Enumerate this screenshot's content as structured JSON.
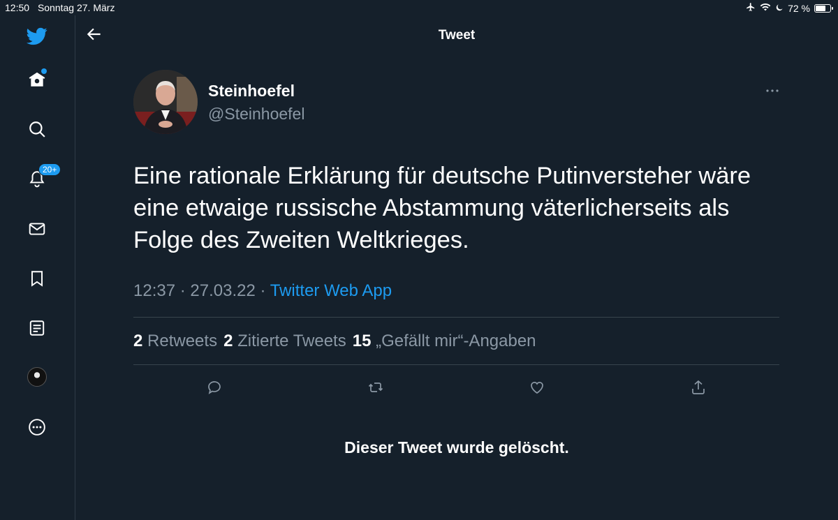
{
  "status_bar": {
    "time": "12:50",
    "date": "Sonntag 27. März",
    "battery": "72 %",
    "battery_level": 0.72
  },
  "sidebar": {
    "notification_count": "20+",
    "items": [
      "twitter-logo",
      "home",
      "explore",
      "notifications",
      "messages",
      "bookmarks",
      "lists",
      "profile",
      "more"
    ]
  },
  "header": {
    "title": "Tweet"
  },
  "tweet": {
    "author_name": "Steinhoefel",
    "author_handle": "@Steinhoefel",
    "text": "Eine rationale Erklärung für deutsche Putinversteher wäre eine etwaige russische Abstammung väterlicherseits als Folge des Zweiten Weltkrieges.",
    "time": "12:37",
    "date": "27.03.22",
    "separator": "·",
    "source": "Twitter Web App",
    "stats": {
      "retweets_count": "2",
      "retweets_label": "Retweets",
      "quotes_count": "2",
      "quotes_label": "Zitierte Tweets",
      "likes_count": "15",
      "likes_label": "„Gefällt mir“-Angaben"
    }
  },
  "deleted_notice": "Dieser Tweet wurde gelöscht.",
  "colors": {
    "background": "#15202b",
    "accent": "#1d9bf0",
    "muted": "#8b98a5",
    "divider": "#38444d"
  }
}
